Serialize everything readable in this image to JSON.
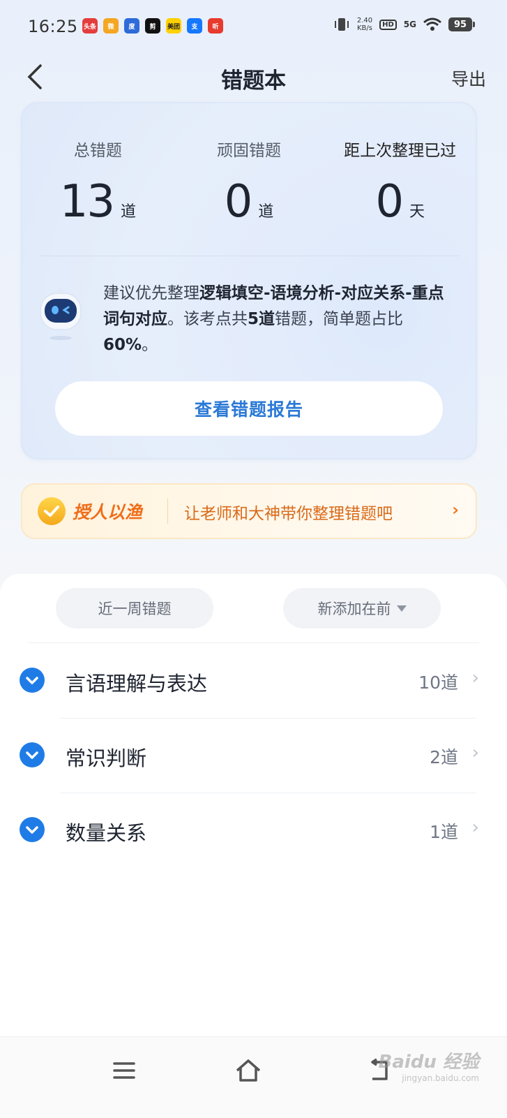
{
  "status_bar": {
    "time": "16:25",
    "network_speed": "2.40",
    "network_unit": "KB/s",
    "hd": "HD",
    "signal": "5G",
    "battery": "95",
    "app_icons": [
      {
        "name": "toutiao-icon",
        "label": "头条",
        "color": "#e43d3d"
      },
      {
        "name": "weibo-icon",
        "label": "微",
        "color": "#f5a623"
      },
      {
        "name": "baidu-icon",
        "label": "度",
        "color": "#2f6bd8"
      },
      {
        "name": "capcut-icon",
        "label": "剪",
        "color": "#111111"
      },
      {
        "name": "meituan-icon",
        "label": "美团",
        "color": "#ffd100"
      },
      {
        "name": "alipay-icon",
        "label": "支",
        "color": "#1677ff"
      },
      {
        "name": "ting-icon",
        "label": "听",
        "color": "#e63b2e"
      }
    ]
  },
  "header": {
    "title": "错题本",
    "export_label": "导出"
  },
  "stats": [
    {
      "label": "总错题",
      "value": "13",
      "unit": "道"
    },
    {
      "label": "顽固错题",
      "value": "0",
      "unit": "道"
    },
    {
      "label": "距上次整理已过",
      "value": "0",
      "unit": "天"
    }
  ],
  "advice": {
    "prefix": "建议优先整理",
    "topic": "逻辑填空-语境分析-对应关系-重点词句对应",
    "mid": "。该考点共",
    "count": "5道",
    "mid2": "错题，简单题占比",
    "percent": "60%",
    "suffix": "。"
  },
  "report_button": "查看错题报告",
  "banner": {
    "brand": "授人以渔",
    "text": "让老师和大神带你整理错题吧",
    "arrow": "›"
  },
  "filters": {
    "time_filter": "近一周错题",
    "sort": "新添加在前"
  },
  "categories": [
    {
      "name": "言语理解与表达",
      "count": "10道"
    },
    {
      "name": "常识判断",
      "count": "2道"
    },
    {
      "name": "数量关系",
      "count": "1道"
    }
  ],
  "watermark": {
    "brand": "Baidu 经验",
    "url": "jingyan.baidu.com"
  }
}
